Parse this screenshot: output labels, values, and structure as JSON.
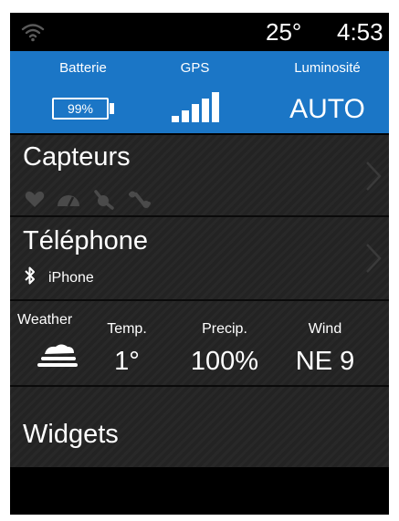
{
  "status_bar": {
    "temperature": "25°",
    "time": "4:53"
  },
  "quick_bar": {
    "battery": {
      "label": "Batterie",
      "value": "99%",
      "level": 0.99
    },
    "gps": {
      "label": "GPS",
      "signal_bars": 5
    },
    "brightness": {
      "label": "Luminosité",
      "value": "AUTO"
    }
  },
  "sections": {
    "sensors": {
      "title": "Capteurs",
      "icons": [
        "heart-rate-icon",
        "speed-icon",
        "cadence-icon",
        "power-icon"
      ]
    },
    "phone": {
      "title": "Téléphone",
      "device": "iPhone",
      "icon": "bluetooth-icon"
    },
    "weather": {
      "title": "Weather",
      "icon": "cloudy-icon",
      "temp_label": "Temp.",
      "temp_value": "1°",
      "precip_label": "Precip.",
      "precip_value": "100%",
      "wind_label": "Wind",
      "wind_value": "NE 9"
    },
    "widgets": {
      "title": "Widgets"
    }
  },
  "colors": {
    "accent": "#1b76c6",
    "panel": "#232323",
    "background": "#000000",
    "text": "#ffffff",
    "dimmed_icon": "#4a4a4a"
  }
}
